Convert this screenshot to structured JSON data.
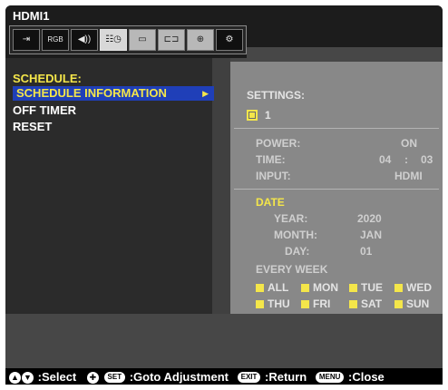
{
  "header": {
    "input_name": "HDMI1",
    "icons": [
      {
        "name": "input-icon",
        "glyph": "⇥"
      },
      {
        "name": "picture-icon",
        "glyph": "RGB"
      },
      {
        "name": "audio-icon",
        "glyph": "◀))"
      },
      {
        "name": "schedule-icon",
        "glyph": "☷◷"
      },
      {
        "name": "slideshow-icon",
        "glyph": "▭"
      },
      {
        "name": "network-icon",
        "glyph": "⊏⊐"
      },
      {
        "name": "protect-icon",
        "glyph": "⊕"
      },
      {
        "name": "system-icon",
        "glyph": "⚙"
      }
    ]
  },
  "menu": {
    "title": "SCHEDULE:",
    "selected_item": "SCHEDULE INFORMATION",
    "items": [
      "OFF TIMER",
      "RESET"
    ]
  },
  "settings": {
    "heading": "SETTINGS:",
    "schedule_number": "1",
    "power_label": "POWER:",
    "power_value": "ON",
    "time_label": "TIME:",
    "time_hour": "04",
    "time_sep": ":",
    "time_min": "03",
    "input_label": "INPUT:",
    "input_value": "HDMI",
    "date_heading": "DATE",
    "year_label": "YEAR:",
    "year_value": "2020",
    "month_label": "MONTH:",
    "month_value": "JAN",
    "day_label": "DAY:",
    "day_value": "01",
    "every_week": "EVERY WEEK",
    "days_row1": [
      "ALL",
      "MON",
      "TUE",
      "WED"
    ],
    "days_row2": [
      "THU",
      "FRI",
      "SAT",
      "SUN"
    ]
  },
  "footer": {
    "select": ":Select",
    "set_btn": "SET",
    "goto": ":Goto Adjustment",
    "exit_btn": "EXIT",
    "return": ":Return",
    "menu_btn": "MENU",
    "close": ":Close"
  },
  "colors": {
    "highlight": "#f4e64a",
    "selection_bar": "#1f3fb8"
  }
}
